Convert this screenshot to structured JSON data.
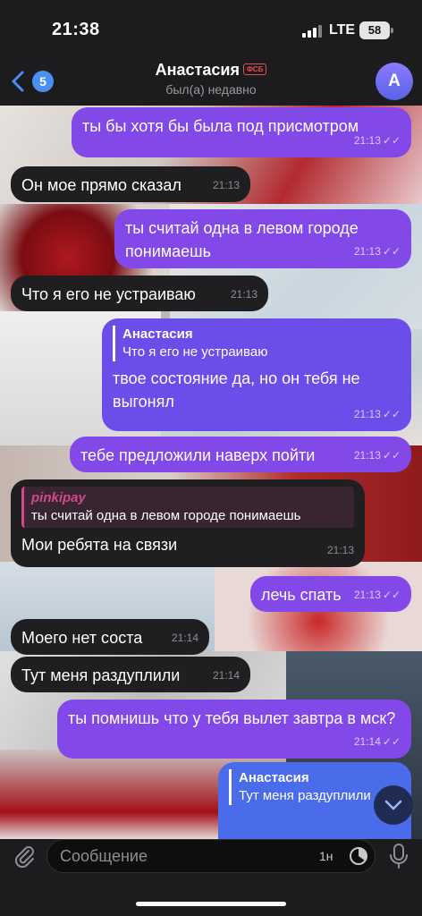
{
  "status_bar": {
    "time": "21:38",
    "network": "LTE",
    "battery": "58"
  },
  "header": {
    "back_count": "5",
    "contact_name": "Анастасия",
    "tag": "ФСБ",
    "status": "был(а) недавно",
    "avatar_letter": "А"
  },
  "messages": [
    {
      "dir": "out",
      "text": "ты бы хотя бы была под присмотром",
      "time": "21:13",
      "read": true
    },
    {
      "dir": "in",
      "text": "Он мое прямо сказал",
      "time": "21:13"
    },
    {
      "dir": "out",
      "text": "ты считай одна в левом городе понимаешь",
      "time": "21:13",
      "read": true
    },
    {
      "dir": "in",
      "text": "Что я его не устраиваю",
      "time": "21:13"
    },
    {
      "dir": "out",
      "reply_name": "Анастасия",
      "reply_text": "Что я его не устраиваю",
      "text": "твое состояние да, но он тебя не выгонял",
      "time": "21:13",
      "read": true
    },
    {
      "dir": "out",
      "text": "тебе предложили наверх пойти",
      "time": "21:13",
      "read": true
    },
    {
      "dir": "in",
      "reply_name": "pinkipay",
      "reply_text": "ты считай одна в левом городе понимаешь",
      "text": "Мои ребята на связи",
      "time": "21:13"
    },
    {
      "dir": "out",
      "text": "лечь спать",
      "time": "21:13",
      "read": true
    },
    {
      "dir": "in",
      "text": "Моего нет соста",
      "time": "21:14"
    },
    {
      "dir": "in",
      "text": "Тут меня раздуплили",
      "time": "21:14"
    },
    {
      "dir": "out",
      "text": "ты помнишь что у тебя вылет завтра в мск?",
      "time": "21:14",
      "read": true
    },
    {
      "dir": "out",
      "reply_name": "Анастасия",
      "reply_text": "Тут меня раздуплили",
      "text": "",
      "time": ""
    }
  ],
  "composer": {
    "placeholder": "Сообщение",
    "timer_label": "1н"
  },
  "colors": {
    "outgoing": "#8348e8",
    "incoming": "#1f1f21",
    "accent": "#4b8ff2"
  }
}
